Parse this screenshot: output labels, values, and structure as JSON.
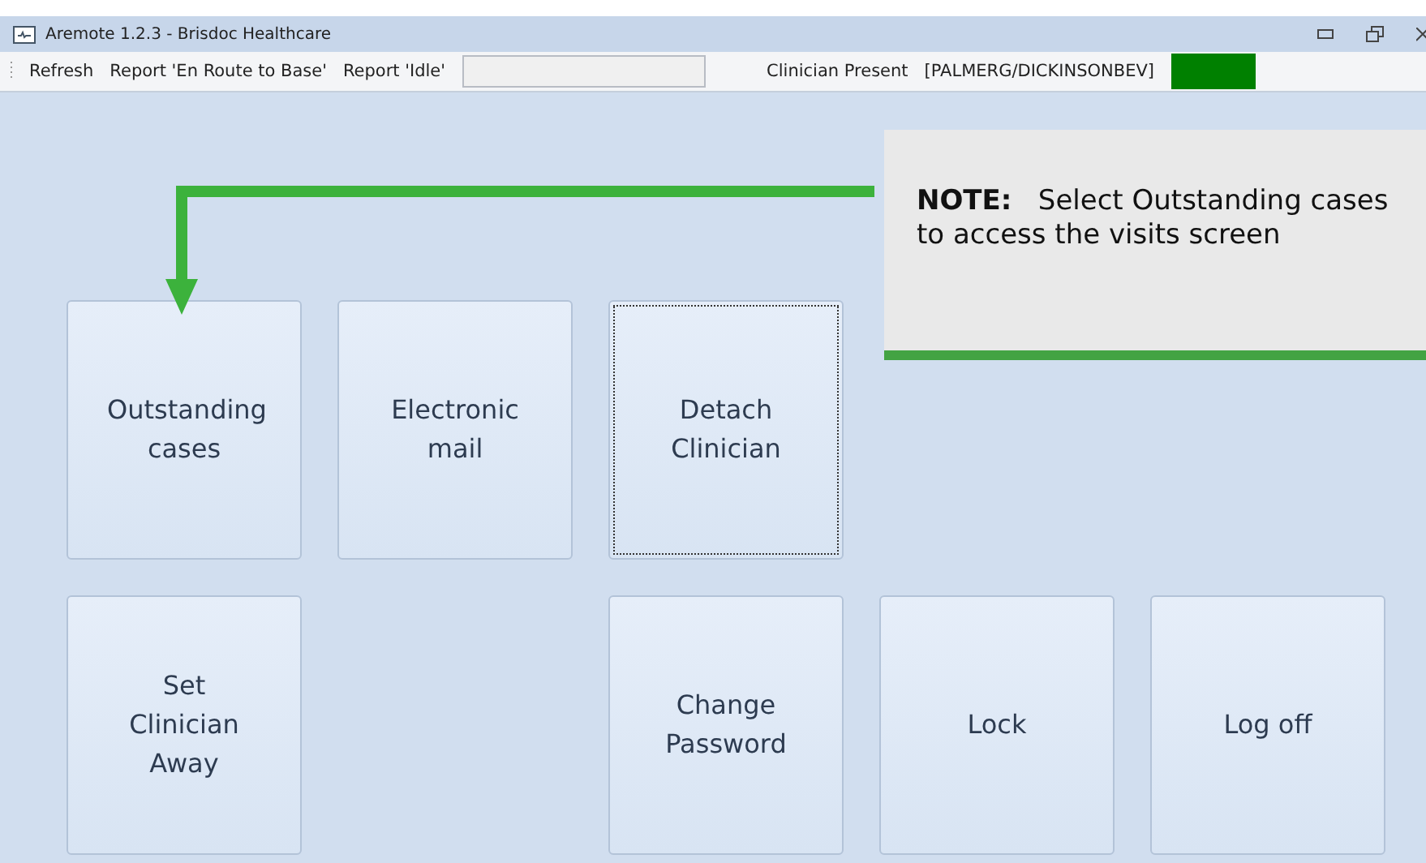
{
  "window": {
    "title": "Aremote 1.2.3 - Brisdoc Healthcare"
  },
  "toolbar": {
    "actions": [
      "Refresh",
      "Report 'En Route to Base'",
      "Report 'Idle'"
    ],
    "status_field": {
      "disabled": true
    },
    "clinician_label": "Clinician Present",
    "clinician": "[PALMERG/DICKINSONBEV]",
    "clinician_present": true
  },
  "tiles": [
    {
      "kind": "button",
      "label": "Outstanding cases",
      "focused": false
    },
    {
      "kind": "button",
      "label": "Electronic mail",
      "focused": false
    },
    {
      "kind": "button",
      "label": "Detach Clinician",
      "focused": true
    },
    {
      "kind": "empty"
    },
    {
      "kind": "empty"
    },
    {
      "kind": "button",
      "label": "Set Clinician Away",
      "focused": false
    },
    {
      "kind": "empty"
    },
    {
      "kind": "button",
      "label": "Change Password",
      "focused": false
    },
    {
      "kind": "button",
      "label": "Lock",
      "focused": false
    },
    {
      "kind": "button",
      "label": "Log off",
      "focused": false
    }
  ],
  "note": {
    "text": "**NOTE:**   Select Outstanding cases to access the visits screen"
  }
}
